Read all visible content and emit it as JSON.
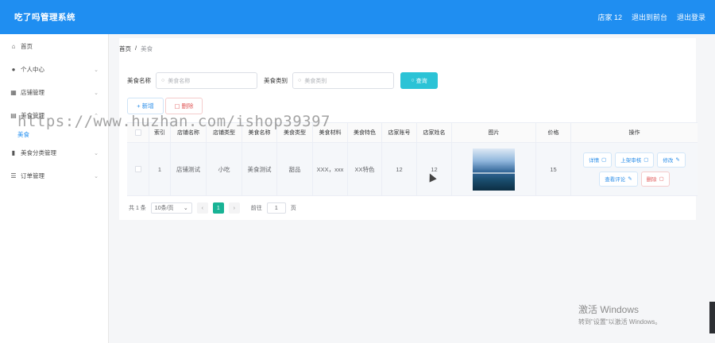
{
  "topbar": {
    "title": "吃了吗管理系统",
    "user": "店家 12",
    "back_to_front": "退出到前台",
    "logout": "退出登录"
  },
  "sidebar": {
    "items": [
      {
        "label": "首页",
        "icon": "home-icon"
      },
      {
        "label": "个人中心",
        "icon": "user-icon"
      },
      {
        "label": "店铺管理",
        "icon": "shop-icon"
      },
      {
        "label": "美食管理",
        "icon": "food-icon"
      },
      {
        "label": "美食分类管理",
        "icon": "bar-chart-icon"
      },
      {
        "label": "订单管理",
        "icon": "list-icon"
      }
    ],
    "sub_active": "美食"
  },
  "breadcrumb": {
    "home": "首页",
    "sep": "/",
    "current": "美食"
  },
  "search": {
    "name_label": "美食名称",
    "name_placeholder": "美食名称",
    "type_label": "美食类别",
    "type_placeholder": "美食类别",
    "button": "查询"
  },
  "actions": {
    "add": "+ 新增",
    "delete": "删除"
  },
  "table": {
    "headers": [
      "",
      "索引",
      "店铺名称",
      "店铺类型",
      "美食名称",
      "美食类型",
      "美食材料",
      "美食特色",
      "店家账号",
      "店家姓名",
      "图片",
      "价格",
      "操作"
    ],
    "row": {
      "index": "1",
      "shop_name": "店铺测试",
      "shop_type": "小吃",
      "food_name": "美食测试",
      "food_type": "甜品",
      "material": "XXX，xxx",
      "feature": "XX特色",
      "account": "12",
      "owner": "12",
      "price": "15",
      "ops": {
        "detail": "详情",
        "shelve": "上架审核",
        "edit": "修改",
        "comments": "查看评论",
        "remove": "删除"
      }
    }
  },
  "pager": {
    "total": "共 1 条",
    "page_size": "10条/页",
    "prev": "‹",
    "current": "1",
    "next": "›",
    "goto_label": "前往",
    "goto_value": "1",
    "page_suffix": "页"
  },
  "overlay": {
    "watermark": "https://www.huzhan.com/ishop39397",
    "windows_title": "激活 Windows",
    "windows_sub": "转到\"设置\"以激活 Windows。"
  },
  "colors": {
    "header": "#1f8ef1",
    "search_button": "#2bc3d6",
    "active_page": "#18b395",
    "danger": "#e05a5a"
  }
}
